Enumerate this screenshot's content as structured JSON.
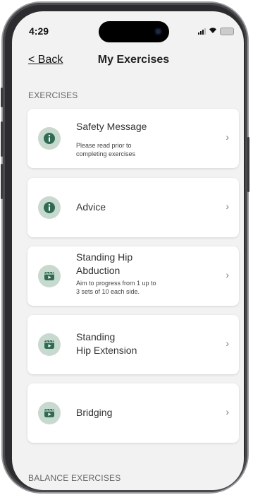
{
  "status_bar": {
    "time": "4:29"
  },
  "nav": {
    "back_label": "< Back",
    "title": "My Exercises"
  },
  "sections": [
    {
      "heading": "EXERCISES"
    },
    {
      "heading": "BALANCE EXERCISES"
    }
  ],
  "exercises": [
    {
      "title_line1": "Safety Message",
      "title_line2": "",
      "subtitle_line1": "Please read prior to",
      "subtitle_line2": "completing exercises",
      "icon": "info-icon"
    },
    {
      "title_line1": "Advice",
      "title_line2": "",
      "subtitle_line1": "",
      "subtitle_line2": "",
      "icon": "info-icon"
    },
    {
      "title_line1": "Standing Hip",
      "title_line2": "Abduction",
      "subtitle_line1": "Aim to progress from 1 up to",
      "subtitle_line2": "3 sets of 10 each side.",
      "icon": "video-icon"
    },
    {
      "title_line1": "Standing",
      "title_line2": "Hip Extension",
      "subtitle_line1": "",
      "subtitle_line2": "",
      "icon": "video-icon"
    },
    {
      "title_line1": "Bridging",
      "title_line2": "",
      "subtitle_line1": "",
      "subtitle_line2": "",
      "icon": "video-icon"
    }
  ],
  "colors": {
    "icon_bg": "#c8d9cf",
    "icon_fg": "#2f6b52",
    "screen_bg": "#f2f2f2"
  }
}
